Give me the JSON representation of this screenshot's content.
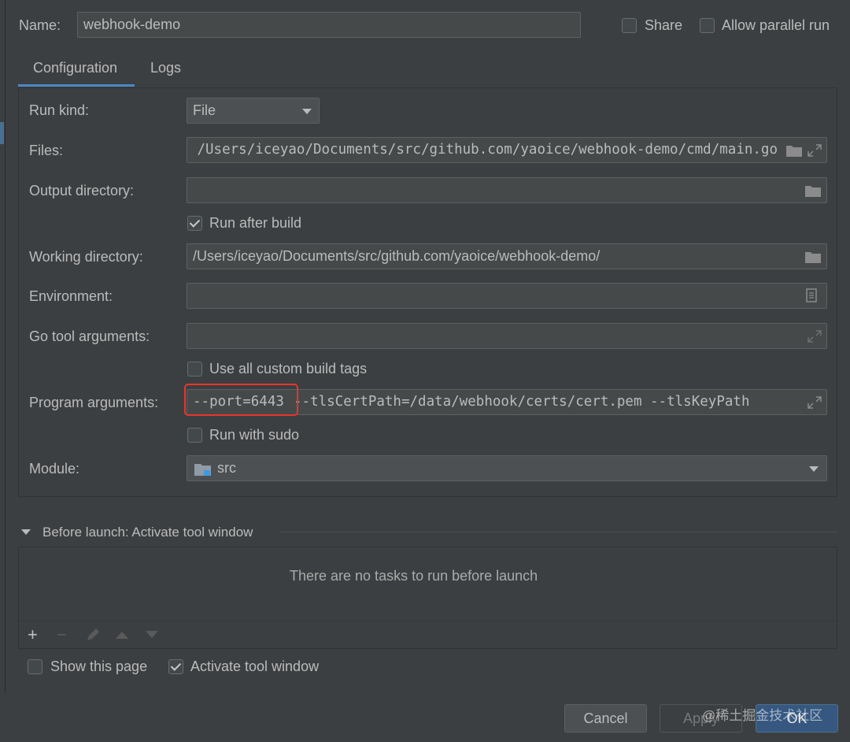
{
  "header": {
    "name_label": "Name:",
    "name_value": "webhook-demo",
    "share_label": "Share",
    "share_checked": false,
    "parallel_label": "Allow parallel run",
    "parallel_checked": false
  },
  "tabs": [
    {
      "label": "Configuration",
      "active": true
    },
    {
      "label": "Logs",
      "active": false
    }
  ],
  "config": {
    "run_kind": {
      "label": "Run kind:",
      "value": "File"
    },
    "files": {
      "label": "Files:",
      "value": "/Users/iceyao/Documents/src/github.com/yaoice/webhook-demo/cmd/main.go"
    },
    "output_dir": {
      "label": "Output directory:",
      "value": ""
    },
    "run_after_build": {
      "label": "Run after build",
      "checked": true
    },
    "working_dir": {
      "label": "Working directory:",
      "value": "/Users/iceyao/Documents/src/github.com/yaoice/webhook-demo/"
    },
    "environment": {
      "label": "Environment:",
      "value": ""
    },
    "go_tool_args": {
      "label": "Go tool arguments:",
      "value": ""
    },
    "custom_build_tags": {
      "label": "Use all custom build tags",
      "checked": false
    },
    "program_args": {
      "label": "Program arguments:",
      "highlighted": "--port=6443",
      "rest": " --tlsCertPath=/data/webhook/certs/cert.pem --tlsKeyPath"
    },
    "run_with_sudo": {
      "label": "Run with sudo",
      "checked": false
    },
    "module": {
      "label": "Module:",
      "value": "src"
    }
  },
  "before_launch": {
    "title": "Before launch: Activate tool window",
    "empty_text": "There are no tasks to run before launch"
  },
  "footer": {
    "show_page": {
      "label": "Show this page",
      "checked": false
    },
    "activate_tool_window": {
      "label": "Activate tool window",
      "checked": true
    }
  },
  "buttons": {
    "cancel": "Cancel",
    "apply": "Apply",
    "ok": "OK"
  },
  "watermark": "@稀土掘金技术社区",
  "colors": {
    "background": "#3c3f41",
    "field": "#45494a",
    "accent": "#4a88c7",
    "highlight_box": "#e8352a"
  }
}
